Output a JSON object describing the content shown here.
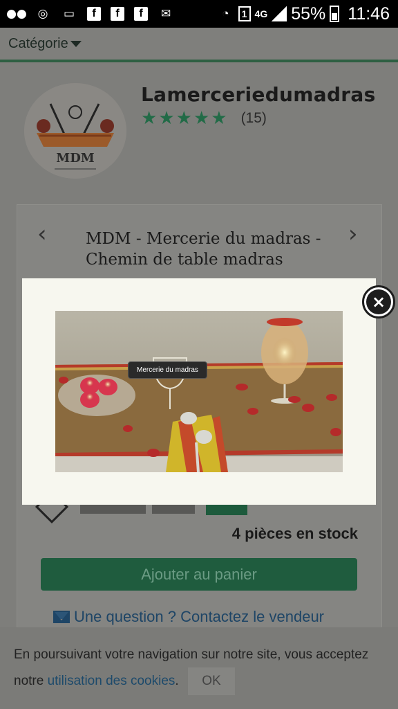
{
  "status_bar": {
    "network": "4G",
    "sim_slot": "1",
    "battery": "55%",
    "time": "11:46"
  },
  "top_nav": {
    "category_label": "Catégorie"
  },
  "shop": {
    "name": "Lamerceriedumadras",
    "rating_stars": 5,
    "rating_count": "(15)",
    "logo_text": "MDM"
  },
  "product": {
    "title": "MDM - Mercerie du madras - Chemin de table madras",
    "stock": "4 pièces en stock",
    "add_to_cart": "Ajouter au panier",
    "contact": "Une question ? Contactez le vendeur"
  },
  "modal": {
    "image_caption": "Mercerie du madras",
    "close_icon": "close-icon"
  },
  "cookie_banner": {
    "text_before": "En poursuivant votre navigation sur notre site, vous acceptez notre ",
    "link_text": "utilisation des cookies",
    "text_after": ".",
    "ok_label": "OK"
  },
  "colors": {
    "brand_green": "#1f5c3e",
    "star_green": "#226b47",
    "link_blue": "#1e4566"
  }
}
